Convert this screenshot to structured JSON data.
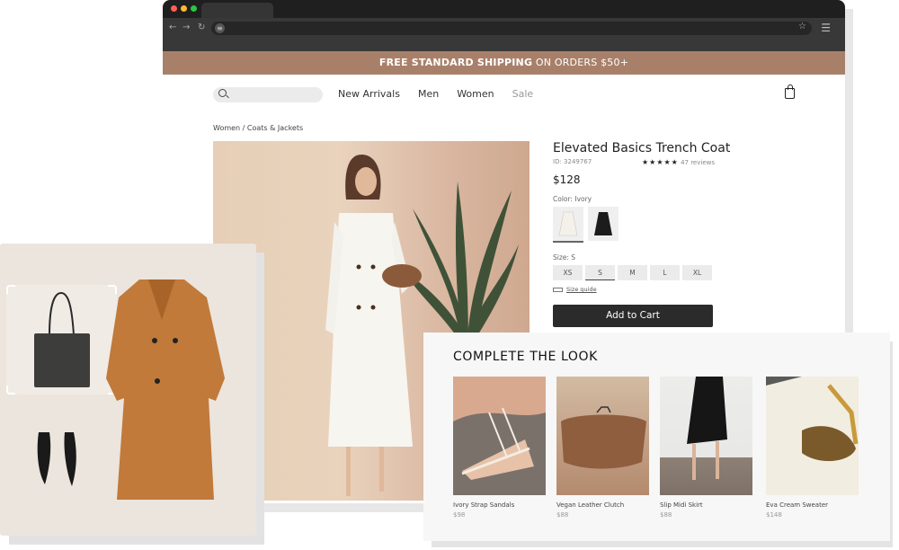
{
  "browser": {
    "traffic_lights": [
      "#ff5f57",
      "#febc2e",
      "#28c840"
    ],
    "nav": {
      "back_icon": "←",
      "forward_icon": "→",
      "reload_icon": "↻",
      "site_icon": "≡",
      "bookmark_icon": "☆",
      "menu_icon": "☰"
    }
  },
  "promo": {
    "bold": "FREE STANDARD SHIPPING",
    "rest": " ON ORDERS $50+"
  },
  "site_nav": {
    "search_placeholder": "",
    "links": [
      "New Arrivals",
      "Men",
      "Women",
      "Sale"
    ]
  },
  "breadcrumb": "Women / Coats & Jackets",
  "product": {
    "title": "Elevated Basics Trench Coat",
    "id": "ID: 3249767",
    "rating_stars": "★★★★★",
    "rating": 5,
    "reviews": "47 reviews",
    "price": "$128",
    "color_label": "Color: Ivory",
    "colors": [
      {
        "name": "Ivory",
        "selected": true
      },
      {
        "name": "Black",
        "selected": false
      }
    ],
    "size_label": "Size: S",
    "sizes": [
      {
        "label": "XS",
        "selected": false
      },
      {
        "label": "S",
        "selected": true
      },
      {
        "label": "M",
        "selected": false
      },
      {
        "label": "L",
        "selected": false
      },
      {
        "label": "XL",
        "selected": false
      }
    ],
    "size_guide": "Size guide",
    "add_to_cart": "Add to Cart"
  },
  "complete_the_look": {
    "title": "COMPLETE THE LOOK",
    "items": [
      {
        "name": "Ivory Strap Sandals",
        "price": "$98"
      },
      {
        "name": "Vegan Leather Clutch",
        "price": "$88"
      },
      {
        "name": "Slip Midi Skirt",
        "price": "$88"
      },
      {
        "name": "Eva Cream Sweater",
        "price": "$148"
      }
    ]
  }
}
